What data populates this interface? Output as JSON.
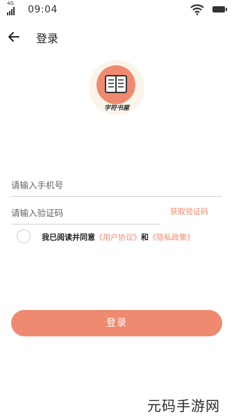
{
  "status_bar": {
    "network": "4G",
    "time": "09:04",
    "icons": [
      "signal-icon",
      "wifi-icon",
      "battery-icon"
    ]
  },
  "nav": {
    "back_icon": "arrow-left-icon",
    "title": "登录"
  },
  "logo": {
    "icon": "book-icon",
    "text": "字符书屋"
  },
  "form": {
    "phone_placeholder": "请输入手机号",
    "code_placeholder": "请输入验证码",
    "get_code_label": "获取验证码"
  },
  "agreement": {
    "checked": false,
    "prefix": "我已阅读并同意",
    "user_agreement": "《用户协议》",
    "and": "和",
    "privacy_policy": "《隐私政策》"
  },
  "login_button": "登录",
  "watermark": "元码手游网",
  "colors": {
    "accent": "#ee8a6f",
    "logo_halo": "#fbf4ea"
  }
}
